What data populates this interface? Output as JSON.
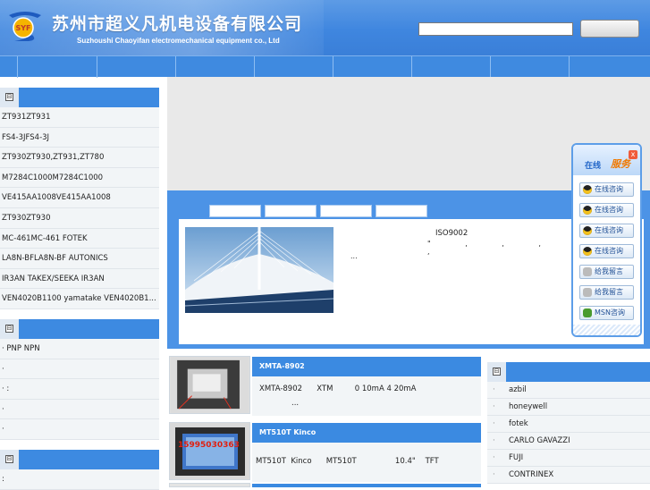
{
  "header": {
    "logo_text": "SYF",
    "brand_cn": "苏州市超义凡机电设备有限公司",
    "brand_en": "Suzhoushi Chaoyifan electromechanical equipment co., Ltd",
    "search_placeholder": "",
    "search_button": ""
  },
  "nav": {
    "items": [
      "",
      "",
      "",
      "",
      "",
      "",
      "",
      "",
      ""
    ]
  },
  "sidebar": {
    "toggle_icon": "⊟",
    "sections": [
      {
        "items": [
          "ZT931ZT931",
          "FS4-3JFS4-3J",
          "ZT930ZT930,ZT931,ZT780",
          "M7284C1000M7284C1000",
          "VE415AA1008VE415AA1008",
          "ZT930ZT930",
          "MC-461MC-461   FOTEK",
          "LA8N-BFLA8N-BF   AUTONICS",
          "IR3AN  TAKEX/SEEKA   IR3AN",
          "VEN4020B1100  yamatake  VEN4020B1..."
        ]
      },
      {
        "items": [
          "·  PNP   NPN",
          "·",
          "·      :",
          "·",
          "·"
        ]
      },
      {
        "items": [
          "   :"
        ]
      }
    ]
  },
  "feature": {
    "tabs": [
      "",
      "",
      "",
      ""
    ],
    "iso_title": "ISO9002",
    "iso_dots": "\" , , , , , ,",
    "ellipsis": "..."
  },
  "chat": {
    "title_a": "在线",
    "title_b": "服务",
    "close": "x",
    "buttons": [
      {
        "label": "在线咨询",
        "type": "qq"
      },
      {
        "label": "在线咨询",
        "type": "qq"
      },
      {
        "label": "在线咨询",
        "type": "qq"
      },
      {
        "label": "在线咨询",
        "type": "qq"
      },
      {
        "label": "给我留言",
        "type": "msg"
      },
      {
        "label": "给我留言",
        "type": "msg"
      },
      {
        "label": "MSN咨询",
        "type": "msn"
      }
    ]
  },
  "products": [
    {
      "title": "XMTA-8902",
      "desc1": "XMTA-8902      XTM         0 10mA 4 20mA",
      "desc2": "...",
      "img_text": ""
    },
    {
      "title": "MT510T    Kinco",
      "desc1": "MT510T  Kinco      MT510T                10.4\"    TFT",
      "desc2": "",
      "img_text": "15995030363"
    }
  ],
  "brands": {
    "items": [
      "azbil",
      " honeywell",
      "fotek",
      "CARLO GAVAZZI",
      "FUJI",
      "CONTRINEX"
    ]
  },
  "colors": {
    "primary": "#3d8ae1",
    "header": "#4a8fe2",
    "accent": "#f07800"
  }
}
